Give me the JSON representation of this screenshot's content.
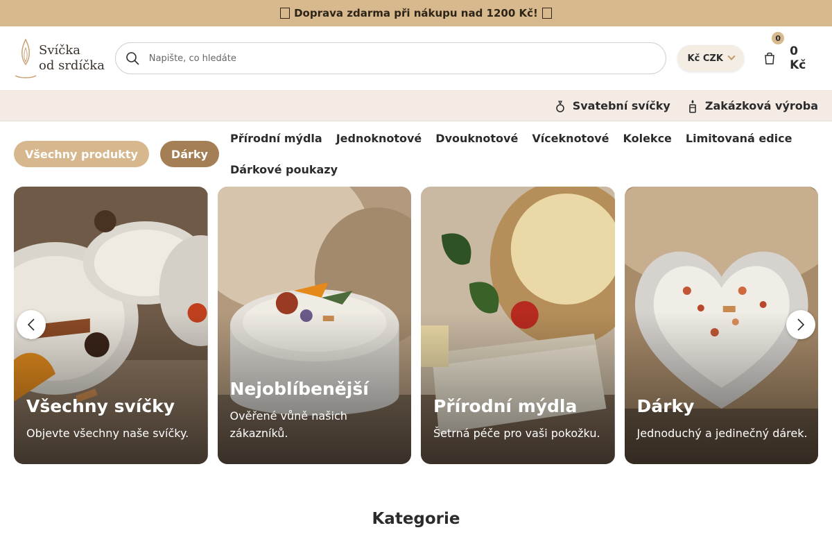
{
  "promo": {
    "text": "Doprava zdarma při nákupu nad 1200 Kč!",
    "icon": "gift-icon"
  },
  "header": {
    "logo_line1": "Svíčka",
    "logo_line2": "od srdíčka",
    "search_placeholder": "Napište, co hledáte",
    "currency": "Kč CZK",
    "cart_count": "0",
    "cart_total": "0 Kč"
  },
  "subnav": [
    {
      "label": "Svatební svíčky",
      "icon": "ring-icon"
    },
    {
      "label": "Zakázková výroba",
      "icon": "candle-icon"
    }
  ],
  "categories": {
    "pills": [
      "Všechny produkty",
      "Dárky"
    ],
    "links": [
      "Přírodní mýdla",
      "Jednoknotové",
      "Dvouknotové",
      "Víceknotové",
      "Kolekce",
      "Limitovaná edice",
      "Dárkové poukazy"
    ]
  },
  "cards": [
    {
      "title": "Všechny svíčky",
      "desc": "Objevte všechny naše svíčky."
    },
    {
      "title": "Nejoblíbenější",
      "desc": "Ověřené vůně našich zákazníků."
    },
    {
      "title": "Přírodní mýdla",
      "desc": "Šetrná péče pro vaši pokožku."
    },
    {
      "title": "Dárky",
      "desc": "Jednoduchý a jedinečný dárek."
    }
  ],
  "section_title": "Kategorie",
  "colors": {
    "promo_bg": "#d8b98e",
    "accent": "#a47f55",
    "pill": "#d6b78e",
    "subnav_bg": "#f3ebe4"
  }
}
